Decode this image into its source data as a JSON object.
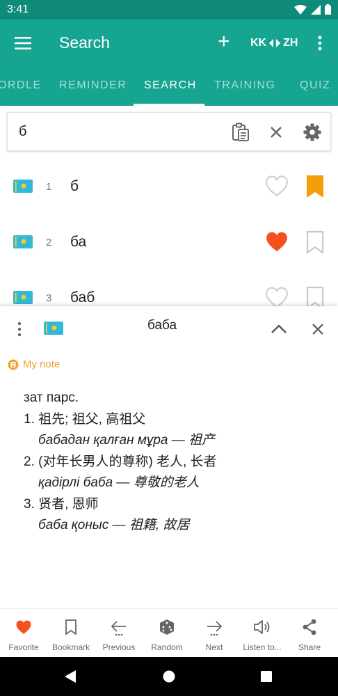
{
  "status_bar": {
    "time": "3:41"
  },
  "app_bar": {
    "title": "Search",
    "lang_from": "KK",
    "lang_to": "ZH"
  },
  "tabs": [
    "ORDLE",
    "REMINDER",
    "SEARCH",
    "TRAINING",
    "QUIZ"
  ],
  "active_tab": "SEARCH",
  "search": {
    "query": "б"
  },
  "results": [
    {
      "num": "1",
      "word": "б",
      "favorite": false,
      "bookmarked": true
    },
    {
      "num": "2",
      "word": "ба",
      "favorite": true,
      "bookmarked": false
    },
    {
      "num": "3",
      "word": "баб",
      "favorite": false,
      "bookmarked": false
    }
  ],
  "detail": {
    "headword": "баба",
    "note_label": "My note",
    "pos": "зат парс.",
    "senses": [
      {
        "def": "1. 祖先; 祖父, 高祖父",
        "example": "бабадан қалған мұра — 祖产"
      },
      {
        "def": "2. (对年长男人的尊称) 老人, 长者",
        "example": "қадірлі баба — 尊敬的老人"
      },
      {
        "def": "3. 贤者, 恩师",
        "example": "баба қоныс — 祖籍, 故居"
      }
    ]
  },
  "bottom_nav": {
    "favorite": "Favorite",
    "bookmark": "Bookmark",
    "previous": "Previous",
    "random": "Random",
    "next": "Next",
    "listen": "Listen to...",
    "share": "Share"
  },
  "colors": {
    "teal": "#16a591",
    "teal_dark": "#0f8a78",
    "heart": "#f4511e",
    "bookmark": "#f59e0b",
    "note": "#f2a12c"
  },
  "icons": {
    "menu": "hamburger-icon",
    "add": "plus-icon",
    "swap": "swap-arrows-icon",
    "more": "more-vert-icon",
    "clipboard": "clipboard-icon",
    "clear": "close-icon",
    "settings": "gear-icon",
    "flag": "kazakhstan-flag-icon",
    "heart": "heart-icon",
    "bookmark": "bookmark-icon"
  }
}
